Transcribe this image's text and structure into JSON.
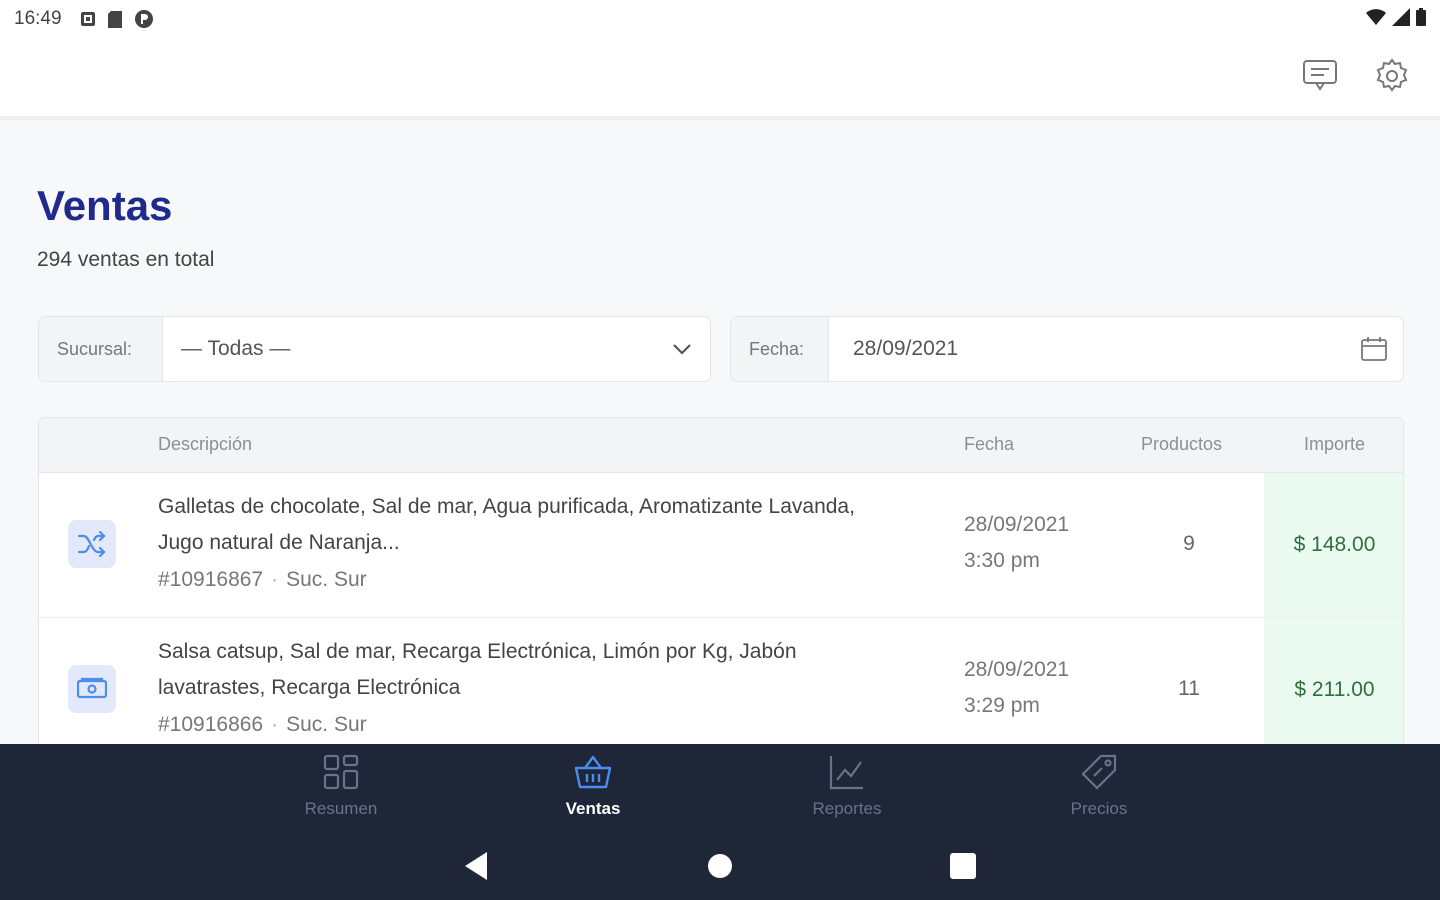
{
  "status_bar": {
    "time": "16:49"
  },
  "app_bar": {
    "actions": [
      "message-icon",
      "settings-icon"
    ]
  },
  "page": {
    "title": "Ventas",
    "subtitle": "294 ventas en total"
  },
  "filters": {
    "branch": {
      "label": "Sucursal:",
      "value": "— Todas —"
    },
    "date": {
      "label": "Fecha:",
      "value": "28/09/2021"
    }
  },
  "table": {
    "headers": {
      "description": "Descripción",
      "date": "Fecha",
      "products": "Productos",
      "amount": "Importe"
    },
    "rows": [
      {
        "icon": "shuffle-icon",
        "description": "Galletas de chocolate, Sal de mar, Agua purificada, Aromatizante Lavanda, Jugo natural de Naranja...",
        "id": "#10916867",
        "branch": "Suc. Sur",
        "date": "28/09/2021",
        "time": "3:30 pm",
        "products": "9",
        "amount": "$ 148.00"
      },
      {
        "icon": "cash-icon",
        "description": "Salsa catsup, Sal de mar, Recarga Electrónica, Limón por Kg, Jabón lavatrastes, Recarga Electrónica",
        "id": "#10916866",
        "branch": "Suc. Sur",
        "date": "28/09/2021",
        "time": "3:29 pm",
        "products": "11",
        "amount": "$ 211.00"
      }
    ]
  },
  "bottom_nav": {
    "items": [
      {
        "label": "Resumen",
        "icon": "grid-icon",
        "active": false
      },
      {
        "label": "Ventas",
        "icon": "basket-icon",
        "active": true
      },
      {
        "label": "Reportes",
        "icon": "chart-icon",
        "active": false
      },
      {
        "label": "Precios",
        "icon": "tag-icon",
        "active": false
      }
    ]
  },
  "colors": {
    "title": "#1f2a8c",
    "accent": "#4a8df0",
    "nav_background": "#1e2638",
    "amount_background": "#ebfaf1"
  }
}
